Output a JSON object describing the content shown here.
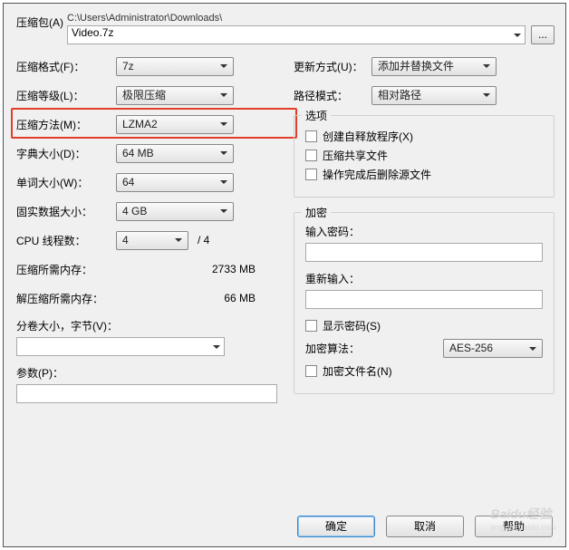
{
  "header": {
    "archive_label": "压缩包(A)",
    "path": "C:\\Users\\Administrator\\Downloads\\",
    "filename": "Video.7z",
    "browse": "..."
  },
  "left": {
    "format_label": "压缩格式(F)：",
    "format_value": "7z",
    "level_label": "压缩等级(L)：",
    "level_value": "极限压缩",
    "method_label": "压缩方法(M)：",
    "method_value": "LZMA2",
    "dict_label": "字典大小(D)：",
    "dict_value": "64 MB",
    "word_label": "单词大小(W)：",
    "word_value": "64",
    "solid_label": "固实数据大小：",
    "solid_value": "4 GB",
    "threads_label": "CPU 线程数：",
    "threads_value": "4",
    "threads_total": "/ 4",
    "mem_comp_label": "压缩所需内存：",
    "mem_comp_value": "2733 MB",
    "mem_decomp_label": "解压缩所需内存：",
    "mem_decomp_value": "66 MB",
    "split_label": "分卷大小，字节(V)：",
    "params_label": "参数(P)："
  },
  "right": {
    "update_label": "更新方式(U)：",
    "update_value": "添加并替换文件",
    "path_label": "路径模式：",
    "path_value": "相对路径",
    "options_title": "选项",
    "opt_sfx": "创建自释放程序(X)",
    "opt_shared": "压缩共享文件",
    "opt_delete": "操作完成后删除源文件",
    "enc_title": "加密",
    "pw_label": "输入密码：",
    "pw2_label": "重新输入：",
    "show_pw": "显示密码(S)",
    "enc_algo_label": "加密算法：",
    "enc_algo_value": "AES-256",
    "enc_names": "加密文件名(N)"
  },
  "footer": {
    "ok": "确定",
    "cancel": "取消",
    "help": "帮助"
  },
  "watermark": {
    "brand": "Baidu经验",
    "sub": "jingyan.baidu.com"
  }
}
